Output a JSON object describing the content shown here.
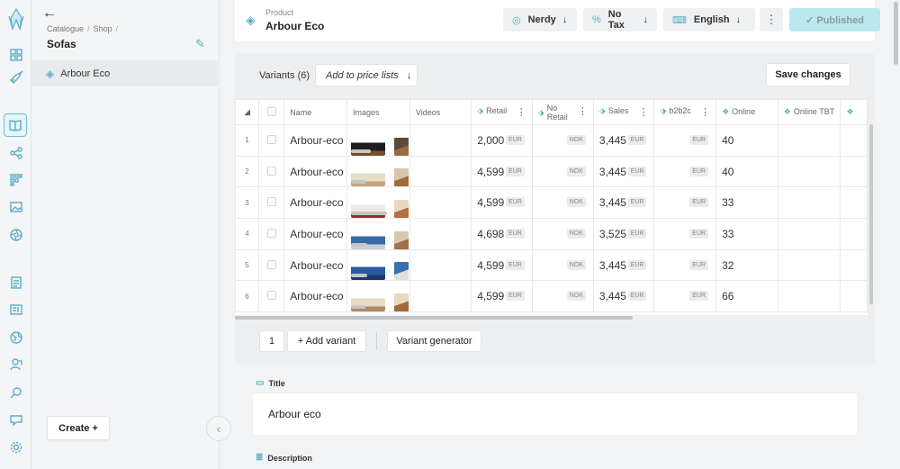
{
  "tree": {
    "back_label": "←",
    "breadcrumbs": [
      "Catalogue",
      "Shop"
    ],
    "title": "Sofas",
    "item": "Arbour Eco",
    "create_label": "Create +"
  },
  "header": {
    "product_label": "Product",
    "product_name": "Arbour Eco",
    "buttons": [
      "Nerdy",
      "No Tax",
      "English"
    ],
    "published_label": "✓ Published"
  },
  "variants": {
    "title": "Variants (6)",
    "add_price_label": "Add to price lists",
    "save_label": "Save changes",
    "columns": {
      "name": "Name",
      "images": "Images",
      "videos": "Videos",
      "retail": "Retail",
      "no_retail": "No Retail",
      "sales": "Sales",
      "b2b2c": "b2b2c",
      "online": "Online",
      "online_tbt": "Online TBT"
    },
    "rows": [
      {
        "num": "1",
        "name": "Arbour-eco",
        "retail": "2,000",
        "retail_cur": "EUR",
        "no_retail_cur": "NOK",
        "sales": "3,445",
        "sales_cur": "EUR",
        "b2b2c_cur": "EUR",
        "online": "40"
      },
      {
        "num": "2",
        "name": "Arbour-eco",
        "retail": "4,599",
        "retail_cur": "EUR",
        "no_retail_cur": "NOK",
        "sales": "3,445",
        "sales_cur": "EUR",
        "b2b2c_cur": "EUR",
        "online": "40"
      },
      {
        "num": "3",
        "name": "Arbour-eco",
        "retail": "4,599",
        "retail_cur": "EUR",
        "no_retail_cur": "NOK",
        "sales": "3,445",
        "sales_cur": "EUR",
        "b2b2c_cur": "EUR",
        "online": "33"
      },
      {
        "num": "4",
        "name": "Arbour-eco",
        "retail": "4,698",
        "retail_cur": "EUR",
        "no_retail_cur": "NOK",
        "sales": "3,525",
        "sales_cur": "EUR",
        "b2b2c_cur": "EUR",
        "online": "33"
      },
      {
        "num": "5",
        "name": "Arbour-eco",
        "retail": "4,599",
        "retail_cur": "EUR",
        "no_retail_cur": "NOK",
        "sales": "3,445",
        "sales_cur": "EUR",
        "b2b2c_cur": "EUR",
        "online": "32"
      },
      {
        "num": "6",
        "name": "Arbour-eco",
        "retail": "4,599",
        "retail_cur": "EUR",
        "no_retail_cur": "NOK",
        "sales": "3,445",
        "sales_cur": "EUR",
        "b2b2c_cur": "EUR",
        "online": "66"
      }
    ],
    "page_number": "1",
    "add_variant_label": "+ Add variant",
    "generator_label": "Variant generator"
  },
  "fields": {
    "title_label": "Title",
    "title_value": "Arbour eco",
    "description_label": "Description"
  },
  "colors": {
    "accent": "#5aaec9",
    "published_bg": "#b9e8f1"
  }
}
